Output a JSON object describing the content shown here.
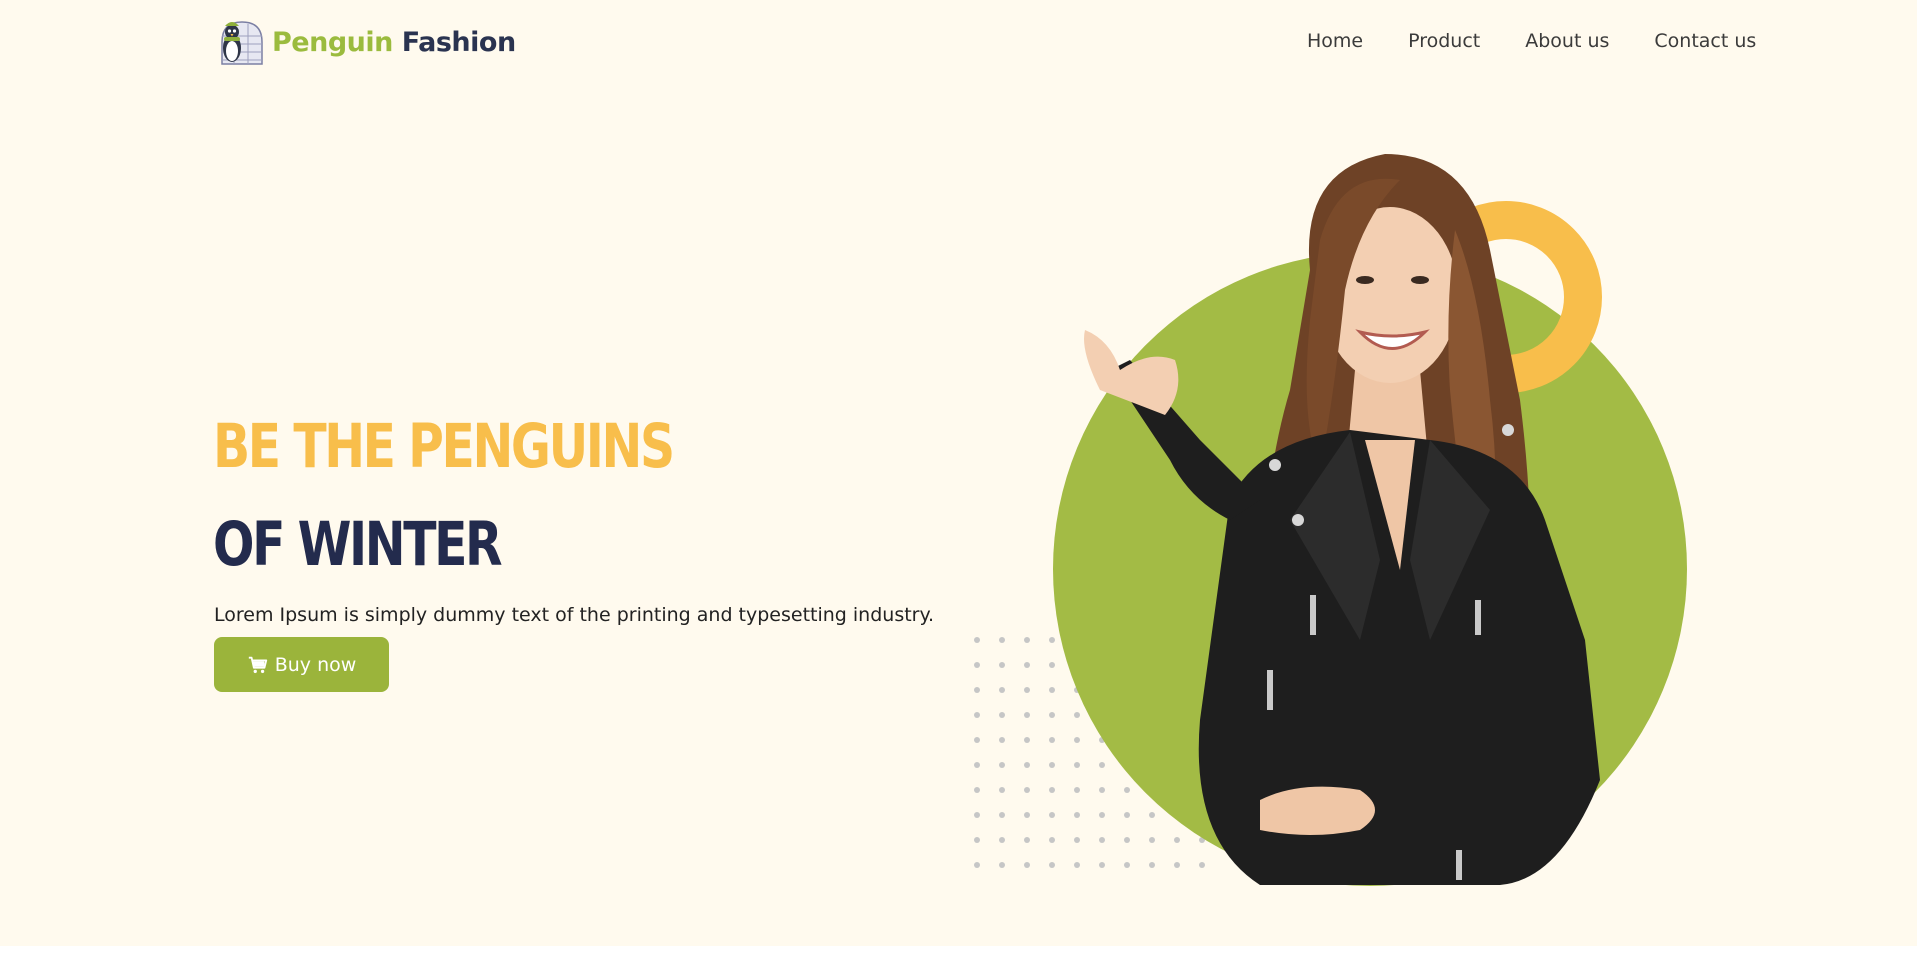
{
  "brand": {
    "word1": "Penguin",
    "word2": "Fashion"
  },
  "nav": {
    "items": [
      "Home",
      "Product",
      "About us",
      "Contact us"
    ]
  },
  "hero": {
    "headline_line1": "BE THE PENGUINS",
    "headline_line2": "OF WINTER",
    "tagline": "Lorem Ipsum is simply dummy text of the printing and typesetting industry.",
    "cta_label": "Buy now"
  },
  "colors": {
    "background": "#fffaee",
    "accent_green": "#9bb43b",
    "accent_yellow": "#f8be4b",
    "navy": "#232b4d"
  },
  "icons": [
    "penguin-logo-icon",
    "cart-icon"
  ]
}
